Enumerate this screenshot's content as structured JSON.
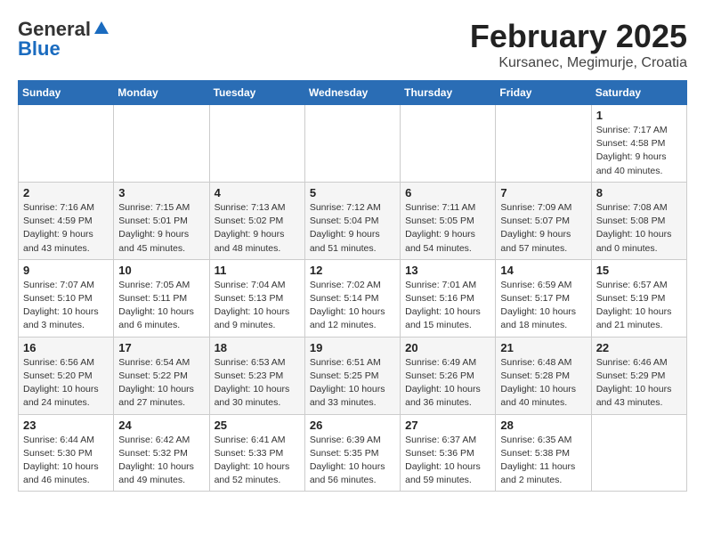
{
  "header": {
    "logo_general": "General",
    "logo_blue": "Blue",
    "month_title": "February 2025",
    "location": "Kursanec, Megimurje, Croatia"
  },
  "days_of_week": [
    "Sunday",
    "Monday",
    "Tuesday",
    "Wednesday",
    "Thursday",
    "Friday",
    "Saturday"
  ],
  "weeks": [
    [
      {
        "day": "",
        "info": ""
      },
      {
        "day": "",
        "info": ""
      },
      {
        "day": "",
        "info": ""
      },
      {
        "day": "",
        "info": ""
      },
      {
        "day": "",
        "info": ""
      },
      {
        "day": "",
        "info": ""
      },
      {
        "day": "1",
        "info": "Sunrise: 7:17 AM\nSunset: 4:58 PM\nDaylight: 9 hours and 40 minutes."
      }
    ],
    [
      {
        "day": "2",
        "info": "Sunrise: 7:16 AM\nSunset: 4:59 PM\nDaylight: 9 hours and 43 minutes."
      },
      {
        "day": "3",
        "info": "Sunrise: 7:15 AM\nSunset: 5:01 PM\nDaylight: 9 hours and 45 minutes."
      },
      {
        "day": "4",
        "info": "Sunrise: 7:13 AM\nSunset: 5:02 PM\nDaylight: 9 hours and 48 minutes."
      },
      {
        "day": "5",
        "info": "Sunrise: 7:12 AM\nSunset: 5:04 PM\nDaylight: 9 hours and 51 minutes."
      },
      {
        "day": "6",
        "info": "Sunrise: 7:11 AM\nSunset: 5:05 PM\nDaylight: 9 hours and 54 minutes."
      },
      {
        "day": "7",
        "info": "Sunrise: 7:09 AM\nSunset: 5:07 PM\nDaylight: 9 hours and 57 minutes."
      },
      {
        "day": "8",
        "info": "Sunrise: 7:08 AM\nSunset: 5:08 PM\nDaylight: 10 hours and 0 minutes."
      }
    ],
    [
      {
        "day": "9",
        "info": "Sunrise: 7:07 AM\nSunset: 5:10 PM\nDaylight: 10 hours and 3 minutes."
      },
      {
        "day": "10",
        "info": "Sunrise: 7:05 AM\nSunset: 5:11 PM\nDaylight: 10 hours and 6 minutes."
      },
      {
        "day": "11",
        "info": "Sunrise: 7:04 AM\nSunset: 5:13 PM\nDaylight: 10 hours and 9 minutes."
      },
      {
        "day": "12",
        "info": "Sunrise: 7:02 AM\nSunset: 5:14 PM\nDaylight: 10 hours and 12 minutes."
      },
      {
        "day": "13",
        "info": "Sunrise: 7:01 AM\nSunset: 5:16 PM\nDaylight: 10 hours and 15 minutes."
      },
      {
        "day": "14",
        "info": "Sunrise: 6:59 AM\nSunset: 5:17 PM\nDaylight: 10 hours and 18 minutes."
      },
      {
        "day": "15",
        "info": "Sunrise: 6:57 AM\nSunset: 5:19 PM\nDaylight: 10 hours and 21 minutes."
      }
    ],
    [
      {
        "day": "16",
        "info": "Sunrise: 6:56 AM\nSunset: 5:20 PM\nDaylight: 10 hours and 24 minutes."
      },
      {
        "day": "17",
        "info": "Sunrise: 6:54 AM\nSunset: 5:22 PM\nDaylight: 10 hours and 27 minutes."
      },
      {
        "day": "18",
        "info": "Sunrise: 6:53 AM\nSunset: 5:23 PM\nDaylight: 10 hours and 30 minutes."
      },
      {
        "day": "19",
        "info": "Sunrise: 6:51 AM\nSunset: 5:25 PM\nDaylight: 10 hours and 33 minutes."
      },
      {
        "day": "20",
        "info": "Sunrise: 6:49 AM\nSunset: 5:26 PM\nDaylight: 10 hours and 36 minutes."
      },
      {
        "day": "21",
        "info": "Sunrise: 6:48 AM\nSunset: 5:28 PM\nDaylight: 10 hours and 40 minutes."
      },
      {
        "day": "22",
        "info": "Sunrise: 6:46 AM\nSunset: 5:29 PM\nDaylight: 10 hours and 43 minutes."
      }
    ],
    [
      {
        "day": "23",
        "info": "Sunrise: 6:44 AM\nSunset: 5:30 PM\nDaylight: 10 hours and 46 minutes."
      },
      {
        "day": "24",
        "info": "Sunrise: 6:42 AM\nSunset: 5:32 PM\nDaylight: 10 hours and 49 minutes."
      },
      {
        "day": "25",
        "info": "Sunrise: 6:41 AM\nSunset: 5:33 PM\nDaylight: 10 hours and 52 minutes."
      },
      {
        "day": "26",
        "info": "Sunrise: 6:39 AM\nSunset: 5:35 PM\nDaylight: 10 hours and 56 minutes."
      },
      {
        "day": "27",
        "info": "Sunrise: 6:37 AM\nSunset: 5:36 PM\nDaylight: 10 hours and 59 minutes."
      },
      {
        "day": "28",
        "info": "Sunrise: 6:35 AM\nSunset: 5:38 PM\nDaylight: 11 hours and 2 minutes."
      },
      {
        "day": "",
        "info": ""
      }
    ]
  ]
}
